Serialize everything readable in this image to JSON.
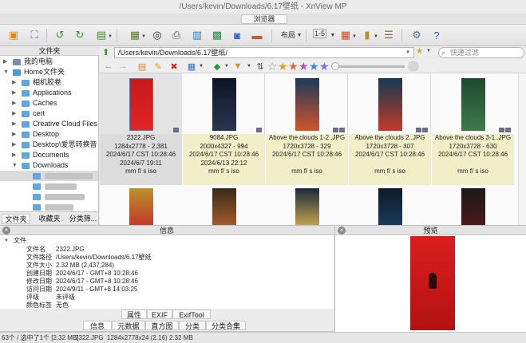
{
  "window": {
    "title": "/Users/kevin/Downloads/6.17壁纸 - XnView MP",
    "tab": "浏览器"
  },
  "toolbar": {
    "layout_label": "布局",
    "view_label": "1-5"
  },
  "tree": {
    "header": "文件夹",
    "items": [
      {
        "label": "我的电脑",
        "icon": "computer-icon",
        "expanded": false
      },
      {
        "label": "Home文件夹",
        "icon": "home-folder-icon",
        "expanded": true
      },
      {
        "label": "相机胶卷",
        "icon": "folder-icon"
      },
      {
        "label": "Applications",
        "icon": "folder-icon"
      },
      {
        "label": "Caches",
        "icon": "folder-icon"
      },
      {
        "label": "cert",
        "icon": "folder-icon"
      },
      {
        "label": "Creative Cloud Files",
        "icon": "folder-icon"
      },
      {
        "label": "Desktop",
        "icon": "folder-icon"
      },
      {
        "label": "Desktop\\爱思转换音",
        "icon": "folder-icon"
      },
      {
        "label": "Documents",
        "icon": "folder-icon"
      },
      {
        "label": "Downloads",
        "icon": "folder-icon",
        "expanded": true
      }
    ],
    "tabs": [
      "文件夹",
      "收藏夹",
      "分类筛..."
    ]
  },
  "address": {
    "path": "/Users/kevin/Downloads/6.17壁纸/",
    "search_placeholder": "快速过滤"
  },
  "thumbnails": [
    {
      "name": "2322.JPG",
      "dims": "1284x2778 - 2,381",
      "modified": "2024/6/17 CST 10:28:46",
      "created": "2024/6/7 19:11",
      "exif": "mm f/ s iso",
      "selected": true,
      "colors": [
        "#c81a1a",
        "#e02424"
      ]
    },
    {
      "name": "9084.JPG",
      "dims": "2000x4327 - 994",
      "modified": "2024/6/17 CST 10:28:46",
      "created": "2024/6/13 22:12",
      "exif": "mm f/ s iso",
      "selected": false,
      "colors": [
        "#0d1424",
        "#2a3550"
      ]
    },
    {
      "name": "Above the clouds 1-2..JPG",
      "dims": "1720x3728 - 329",
      "modified": "2024/6/17 CST 10:28:46",
      "created": "",
      "exif": "mm f/ s iso",
      "selected": false,
      "colors": [
        "#1b3a5a",
        "#d0552a"
      ]
    },
    {
      "name": "Above the clouds 2..JPG",
      "dims": "1720x3728 - 307",
      "modified": "2024/6/17 CST 10:28:46",
      "created": "",
      "exif": "mm f/ s iso",
      "selected": false,
      "colors": [
        "#123a52",
        "#c43a2a"
      ]
    },
    {
      "name": "Above the clouds 3-1..JPG",
      "dims": "1720x3728 - 630",
      "modified": "2024/6/17 CST 10:28:46",
      "created": "",
      "exif": "mm f/ s iso",
      "selected": false,
      "colors": [
        "#1f4a2e",
        "#3f7a4a"
      ]
    }
  ],
  "thumbnails_row2": [
    {
      "colors": [
        "#b8922a",
        "#c23a2a"
      ]
    },
    {
      "colors": [
        "#3a2a1a",
        "#a05a2a"
      ]
    },
    {
      "colors": [
        "#1a2a3a",
        "#c0a050"
      ]
    },
    {
      "colors": [
        "#0d1a2a",
        "#1a3a5a"
      ]
    },
    {
      "colors": [
        "#1a1a1a",
        "#4a1a1a"
      ]
    }
  ],
  "info": {
    "header": "信息",
    "section": "文件",
    "rows": [
      {
        "key": "文件名",
        "value": "2322.JPG"
      },
      {
        "key": "文件路径",
        "value": "/Users/kevin/Downloads/6.17壁纸"
      },
      {
        "key": "文件大小",
        "value": "2.32 MB (2,437,284)"
      },
      {
        "key": "创建日期",
        "value": "2024/6/17 - GMT+8 10:28:46"
      },
      {
        "key": "修改日期",
        "value": "2024/6/17 - GMT+8 10:28:46"
      },
      {
        "key": "访问日期",
        "value": "2024/9/11 - GMT+8 14:03:25"
      },
      {
        "key": "评级",
        "value": "未评级"
      },
      {
        "key": "颜色标签",
        "value": "无色"
      }
    ],
    "tabs_top": [
      "属性",
      "EXIF",
      "ExifTool"
    ],
    "tabs_bottom": [
      "信息",
      "元数据",
      "直方图",
      "分类",
      "分类合集"
    ]
  },
  "preview": {
    "header": "预览"
  },
  "status": {
    "count": "63个 / 选中了1个 [2.32 MB]",
    "file": "2322.JPG",
    "details": "1284x2778x24 (2.16)",
    "size": "2.32 MB"
  },
  "colors": {
    "accent_blue": "#5fa7e0",
    "selected_image": "#c81a1a",
    "meta_bg": "#f1efc8"
  }
}
